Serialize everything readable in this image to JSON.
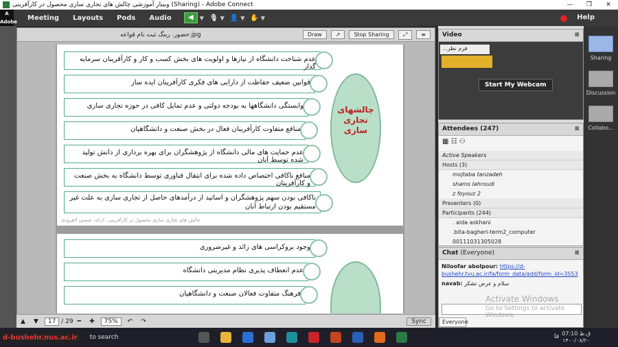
{
  "window": {
    "title": "وبینار آموزشی چالش های تجاری سازی محصول در کارآفرینی (Sharing) - Adobe Connect",
    "logo_text": "Adobe"
  },
  "menu": {
    "items": [
      "Meeting",
      "Layouts",
      "Pods",
      "Audio"
    ],
    "help": "Help"
  },
  "share_pod": {
    "file_name": "حضور. ربنگ ثبت نام قواعه.jpg",
    "draw_label": "Draw",
    "stop_sharing_label": "Stop Sharing",
    "page_current": "17",
    "page_total": "/ 29",
    "zoom": "75%",
    "sync_label": "Sync",
    "slide1": {
      "title_circle": "چالشهای تجاری سازی",
      "rows": [
        "عدم شناخت دانشگاه از نیازها و اولویت های بخش کسب و کار و کارآفرینان سرمایه گذار",
        "قوانین ضعیف حفاظت از دارایی های فکری کارآفرینان ایده ساز",
        "وابستگی دانشگاهها به بودجه دولتی و عدم تمایل کافی در حوزه تجاری سازی",
        "منافع متفاوت کارآفرینان فعال در بخش صنعت و دانشگاهیان",
        "عدم حمایت های مالی دانشگاه از پژوهشگران برای بهره برداری از دانش تولید شده توسط آنان",
        "منافع ناکافی اختصاص داده شده برای انتقال فناوری توسط دانشگاه به بخش صنعت و کارآفرینان",
        "ناکافی بودن سهم پژوهشگران و اساتید از درآمدهای حاصل از تجاری سازی به علت غیر مستقیم بودن ارتباط آنان"
      ],
      "footer": "چالش های تجاری سازی محصول در کارآفرینی ، ارائه: شمس لاهرودی"
    },
    "slide2": {
      "rows": [
        "وجود بروکراسی های زائد و غیرضروری",
        "عدم انعطاف پذیری نظام مدیریتی دانشگاه",
        "فرهنگ متفاوت فعالان صنعت و دانشگاهیان"
      ]
    }
  },
  "video_pod": {
    "title": "Video",
    "feed_label": "...فرم نظر",
    "button": "Start My Webcam"
  },
  "attendees_pod": {
    "title": "Attendees",
    "count": "(247)",
    "active_speakers": "Active Speakers",
    "hosts_label": "Hosts (3)",
    "hosts": [
      "mojtaba tanzadeh",
      "shams lahroudi",
      "z foyouz 2"
    ],
    "presenters_label": "Presenters (0)",
    "participants_label": "Participants (244)",
    "participants": [
      ". aida askhani",
      ".bita-bagheri-term2_computer",
      "00111031305028"
    ]
  },
  "chat_pod": {
    "title": "Chat",
    "scope": "(Everyone)",
    "messages": [
      {
        "sender": "Niloofar abolpour:",
        "text": "https://d-bushehr.tvu.ac.ir/fa/form_data/add/form_id=3553"
      },
      {
        "sender": "navab:",
        "text": "سلام و عرض تشکر"
      }
    ],
    "watermark1": "Activate Windows",
    "watermark2": "Go to Settings to activate Windows.",
    "tab": "Everyone"
  },
  "layouts": {
    "items": [
      "Sharing",
      "Discussion",
      "Collabo..."
    ]
  },
  "taskbar": {
    "url_badge": "d-bushehr.nus.ac.ir",
    "search": "to search",
    "lang": "فا",
    "time": "07:10 ق.ظ",
    "date": "۱۴۰۰/۰۸/۲۰"
  },
  "colors": {
    "accent_green": "#b9dfc9",
    "title_red": "#c21d1d"
  }
}
